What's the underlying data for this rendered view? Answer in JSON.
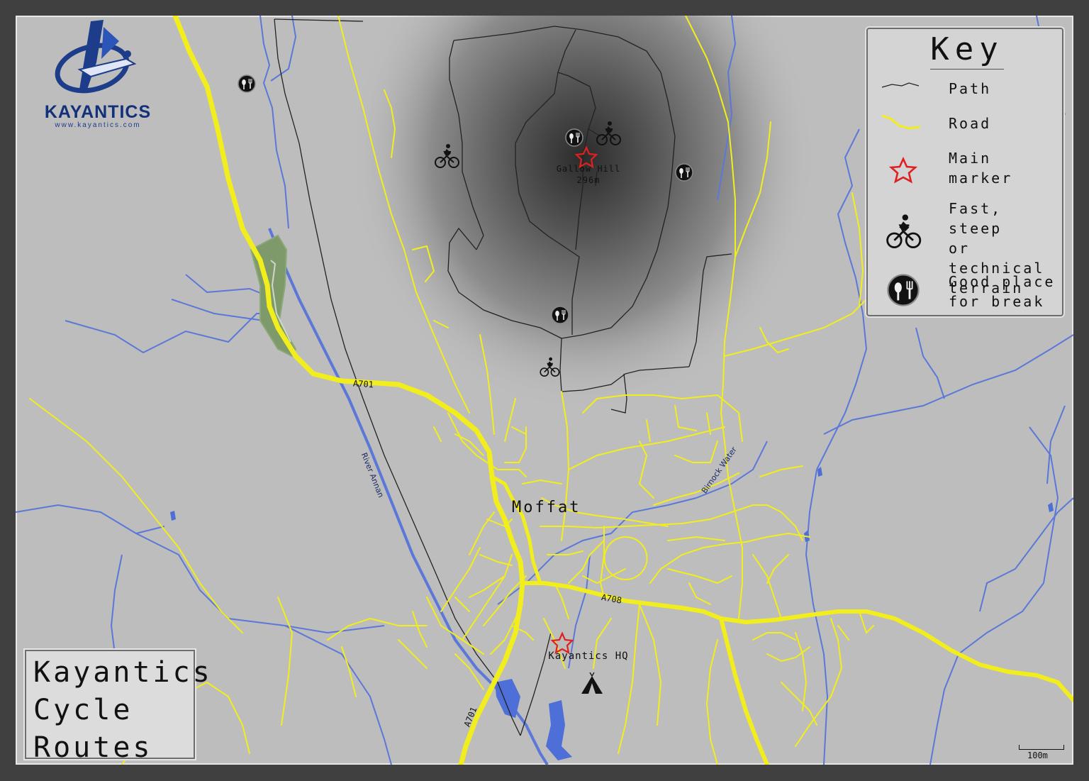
{
  "title": {
    "lines": [
      "Kayantics",
      "Cycle",
      "Routes"
    ]
  },
  "logo": {
    "brand": "KAYANTICS",
    "url": "www.kayantics.com"
  },
  "key": {
    "title": "Key",
    "items": [
      {
        "icon": "path-line-icon",
        "label": "Path"
      },
      {
        "icon": "road-line-icon",
        "label": "Road"
      },
      {
        "icon": "star-icon",
        "label": "Main\nmarker"
      },
      {
        "icon": "cyclist-icon",
        "label": "Fast, steep\nor technical\nterrain"
      },
      {
        "icon": "break-icon",
        "label": "Good place\nfor break"
      }
    ]
  },
  "labels": {
    "town": "Moffat",
    "hill_name": "Gallow Hill",
    "hill_height": "296m",
    "hq": "Kayantics HQ",
    "road_a701_north": "A701",
    "road_a701_south": "A701",
    "road_a708": "A708",
    "river_annan": "River Annan",
    "birnock_water": "Birnock Water"
  },
  "scale": {
    "label": "100m"
  },
  "colors": {
    "road": "#f2ee1e",
    "path": "#222222",
    "water": "#5b78d8",
    "marker": "#e02020",
    "park": "#7e9a6a",
    "background": "#bdbdbd"
  }
}
